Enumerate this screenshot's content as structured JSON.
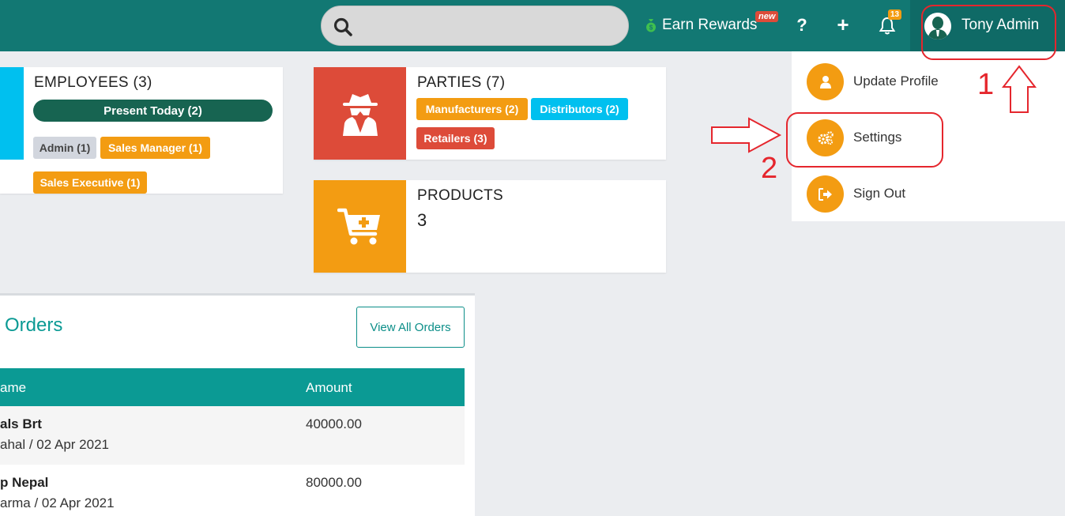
{
  "header": {
    "search": {
      "placeholder": "",
      "value": ""
    },
    "earn_rewards": "Earn Rewards",
    "new_badge": "new",
    "help_label": "?",
    "add_label": "+",
    "notification_count": "13",
    "user_name": "Tony Admin"
  },
  "employees_card": {
    "title": "EMPLOYEES (3)",
    "present_today": "Present Today (2)",
    "roles": [
      "Admin (1)",
      "Sales Manager (1)",
      "Sales Executive (1)"
    ]
  },
  "parties_card": {
    "title": "PARTIES (7)",
    "types": [
      "Manufacturers (2)",
      "Distributors (2)",
      "Retailers (3)"
    ]
  },
  "products_card": {
    "title": "PRODUCTS",
    "count": "3"
  },
  "orders": {
    "title": "Orders",
    "view_all": "View All Orders",
    "columns": [
      "ame",
      "Amount"
    ],
    "rows": [
      {
        "name": "als Brt",
        "sub": "ahal / 02 Apr 2021",
        "amount": "40000.00"
      },
      {
        "name": "p Nepal",
        "sub": "arma / 02 Apr 2021",
        "amount": "80000.00"
      }
    ]
  },
  "user_menu": {
    "items": [
      {
        "label": "Update Profile",
        "icon": "user-icon"
      },
      {
        "label": "Settings",
        "icon": "gears-icon"
      },
      {
        "label": "Sign Out",
        "icon": "sign-out-icon"
      }
    ]
  },
  "annotations": {
    "step1": "1",
    "step2": "2"
  },
  "colors": {
    "topbar": "#127873",
    "teal": "#0b9a94",
    "orange": "#f39c12",
    "red": "#dd4b39",
    "cyan": "#00c0ef",
    "dark_green": "#176451",
    "annotation_red": "#e5262d"
  }
}
